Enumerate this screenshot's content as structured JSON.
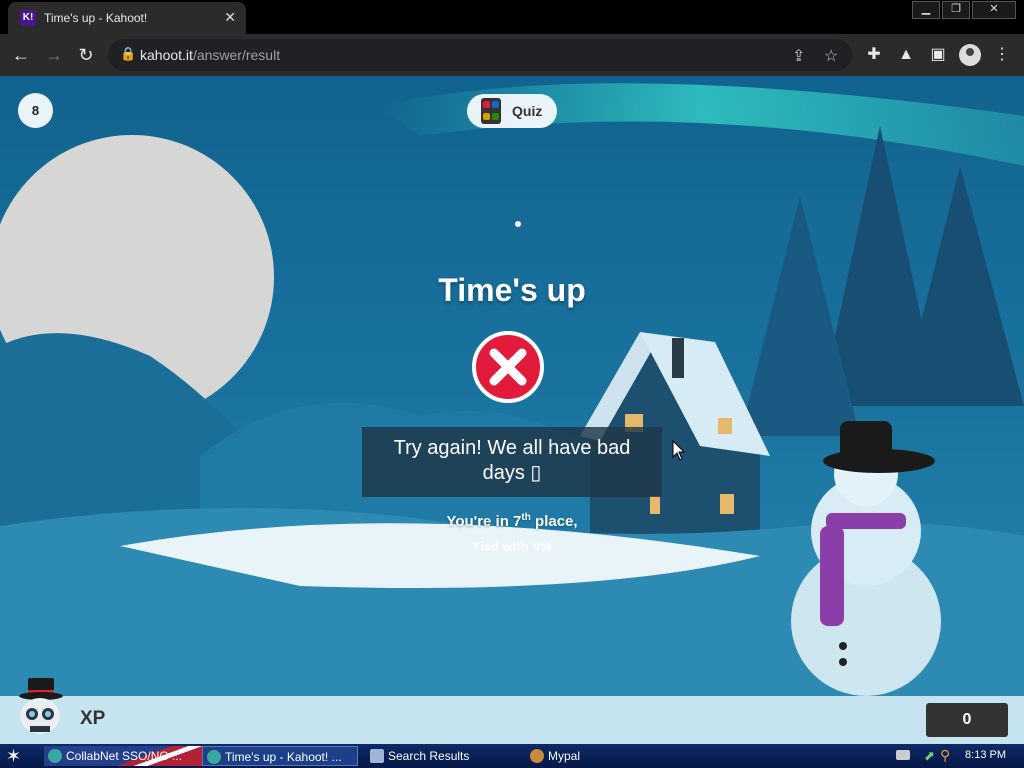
{
  "browser": {
    "tab_title": "Time's up - Kahoot!",
    "tab_favicon_text": "K!",
    "url_domain": "kahoot.it",
    "url_path": "/answer/result",
    "window_controls": {
      "minimize": "▁",
      "restore": "❐",
      "close": "✕"
    }
  },
  "game": {
    "question_number": "8",
    "quiz_label": "Quiz",
    "result_title": "Time's up",
    "result_icon": "x-mark-icon",
    "message": "Try again! We all have bad days ▯",
    "place_prefix": "You're in 7",
    "place_suffix_sup": "th",
    "place_rest": " place,",
    "tied_text": "Tied with VM"
  },
  "player": {
    "nickname": "XP",
    "score": "0"
  },
  "taskbar": {
    "tasks": [
      {
        "label": "CollabNet SSO/NG ..."
      },
      {
        "label": "Time's up - Kahoot! ..."
      },
      {
        "label": "Search Results"
      },
      {
        "label": "Mypal"
      }
    ],
    "clock": "8:13 PM"
  },
  "colors": {
    "kahoot_purple": "#46178f",
    "wrong_red": "#e21b3c",
    "bar_light": "#c6e3f0",
    "score_dark": "#333333"
  }
}
